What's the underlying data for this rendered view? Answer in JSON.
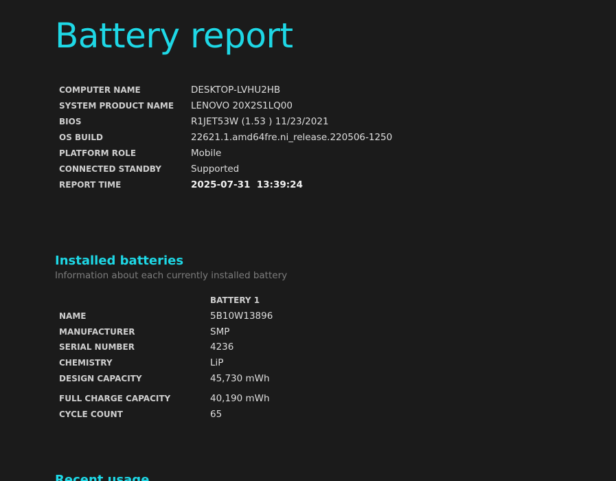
{
  "report": {
    "title": "Battery report"
  },
  "system_info": {
    "rows": [
      {
        "label": "COMPUTER NAME",
        "value": "DESKTOP-LVHU2HB"
      },
      {
        "label": "SYSTEM PRODUCT NAME",
        "value": "LENOVO 20X2S1LQ00"
      },
      {
        "label": "BIOS",
        "value": "R1JET53W (1.53 ) 11/23/2021"
      },
      {
        "label": "OS BUILD",
        "value": "22621.1.amd64fre.ni_release.220506-1250"
      },
      {
        "label": "PLATFORM ROLE",
        "value": "Mobile"
      },
      {
        "label": "CONNECTED STANDBY",
        "value": "Supported"
      },
      {
        "label": "REPORT TIME",
        "value": "2025-07-31  13:39:24"
      }
    ]
  },
  "installed_batteries": {
    "title": "Installed batteries",
    "subtitle": "Information about each currently installed battery",
    "column_header": "BATTERY 1",
    "rows": [
      {
        "label": "NAME",
        "value": "5B10W13896"
      },
      {
        "label": "MANUFACTURER",
        "value": "SMP"
      },
      {
        "label": "SERIAL NUMBER",
        "value": "4236"
      },
      {
        "label": "CHEMISTRY",
        "value": "LiP"
      },
      {
        "label": "DESIGN CAPACITY",
        "value": "45,730 mWh"
      },
      {
        "label": "FULL CHARGE CAPACITY",
        "value": "40,190 mWh"
      },
      {
        "label": "CYCLE COUNT",
        "value": "65"
      }
    ]
  },
  "recent_usage": {
    "title": "Recent usage"
  },
  "colors": {
    "background": "#1b1b1b",
    "accent": "#1ed8e6",
    "subtitle": "#7d7d7d"
  }
}
